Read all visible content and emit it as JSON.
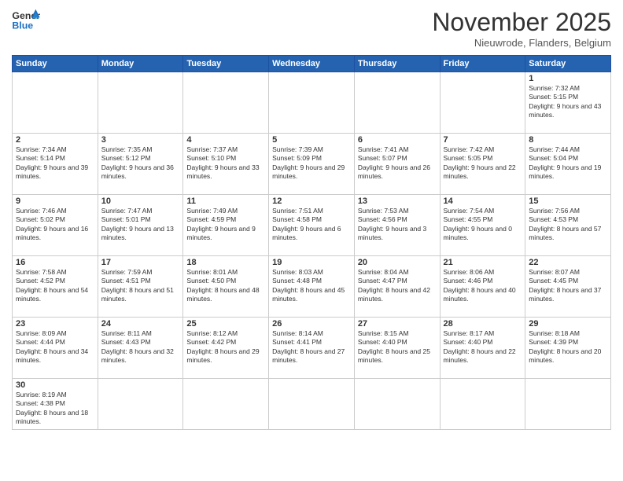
{
  "logo": {
    "line1": "General",
    "line2": "Blue"
  },
  "header": {
    "month": "November 2025",
    "location": "Nieuwrode, Flanders, Belgium"
  },
  "weekdays": [
    "Sunday",
    "Monday",
    "Tuesday",
    "Wednesday",
    "Thursday",
    "Friday",
    "Saturday"
  ],
  "days": {
    "1": {
      "sunrise": "7:32 AM",
      "sunset": "5:15 PM",
      "daylight": "9 hours and 43 minutes."
    },
    "2": {
      "sunrise": "7:34 AM",
      "sunset": "5:14 PM",
      "daylight": "9 hours and 39 minutes."
    },
    "3": {
      "sunrise": "7:35 AM",
      "sunset": "5:12 PM",
      "daylight": "9 hours and 36 minutes."
    },
    "4": {
      "sunrise": "7:37 AM",
      "sunset": "5:10 PM",
      "daylight": "9 hours and 33 minutes."
    },
    "5": {
      "sunrise": "7:39 AM",
      "sunset": "5:09 PM",
      "daylight": "9 hours and 29 minutes."
    },
    "6": {
      "sunrise": "7:41 AM",
      "sunset": "5:07 PM",
      "daylight": "9 hours and 26 minutes."
    },
    "7": {
      "sunrise": "7:42 AM",
      "sunset": "5:05 PM",
      "daylight": "9 hours and 22 minutes."
    },
    "8": {
      "sunrise": "7:44 AM",
      "sunset": "5:04 PM",
      "daylight": "9 hours and 19 minutes."
    },
    "9": {
      "sunrise": "7:46 AM",
      "sunset": "5:02 PM",
      "daylight": "9 hours and 16 minutes."
    },
    "10": {
      "sunrise": "7:47 AM",
      "sunset": "5:01 PM",
      "daylight": "9 hours and 13 minutes."
    },
    "11": {
      "sunrise": "7:49 AM",
      "sunset": "4:59 PM",
      "daylight": "9 hours and 9 minutes."
    },
    "12": {
      "sunrise": "7:51 AM",
      "sunset": "4:58 PM",
      "daylight": "9 hours and 6 minutes."
    },
    "13": {
      "sunrise": "7:53 AM",
      "sunset": "4:56 PM",
      "daylight": "9 hours and 3 minutes."
    },
    "14": {
      "sunrise": "7:54 AM",
      "sunset": "4:55 PM",
      "daylight": "9 hours and 0 minutes."
    },
    "15": {
      "sunrise": "7:56 AM",
      "sunset": "4:53 PM",
      "daylight": "8 hours and 57 minutes."
    },
    "16": {
      "sunrise": "7:58 AM",
      "sunset": "4:52 PM",
      "daylight": "8 hours and 54 minutes."
    },
    "17": {
      "sunrise": "7:59 AM",
      "sunset": "4:51 PM",
      "daylight": "8 hours and 51 minutes."
    },
    "18": {
      "sunrise": "8:01 AM",
      "sunset": "4:50 PM",
      "daylight": "8 hours and 48 minutes."
    },
    "19": {
      "sunrise": "8:03 AM",
      "sunset": "4:48 PM",
      "daylight": "8 hours and 45 minutes."
    },
    "20": {
      "sunrise": "8:04 AM",
      "sunset": "4:47 PM",
      "daylight": "8 hours and 42 minutes."
    },
    "21": {
      "sunrise": "8:06 AM",
      "sunset": "4:46 PM",
      "daylight": "8 hours and 40 minutes."
    },
    "22": {
      "sunrise": "8:07 AM",
      "sunset": "4:45 PM",
      "daylight": "8 hours and 37 minutes."
    },
    "23": {
      "sunrise": "8:09 AM",
      "sunset": "4:44 PM",
      "daylight": "8 hours and 34 minutes."
    },
    "24": {
      "sunrise": "8:11 AM",
      "sunset": "4:43 PM",
      "daylight": "8 hours and 32 minutes."
    },
    "25": {
      "sunrise": "8:12 AM",
      "sunset": "4:42 PM",
      "daylight": "8 hours and 29 minutes."
    },
    "26": {
      "sunrise": "8:14 AM",
      "sunset": "4:41 PM",
      "daylight": "8 hours and 27 minutes."
    },
    "27": {
      "sunrise": "8:15 AM",
      "sunset": "4:40 PM",
      "daylight": "8 hours and 25 minutes."
    },
    "28": {
      "sunrise": "8:17 AM",
      "sunset": "4:40 PM",
      "daylight": "8 hours and 22 minutes."
    },
    "29": {
      "sunrise": "8:18 AM",
      "sunset": "4:39 PM",
      "daylight": "8 hours and 20 minutes."
    },
    "30": {
      "sunrise": "8:19 AM",
      "sunset": "4:38 PM",
      "daylight": "8 hours and 18 minutes."
    }
  }
}
